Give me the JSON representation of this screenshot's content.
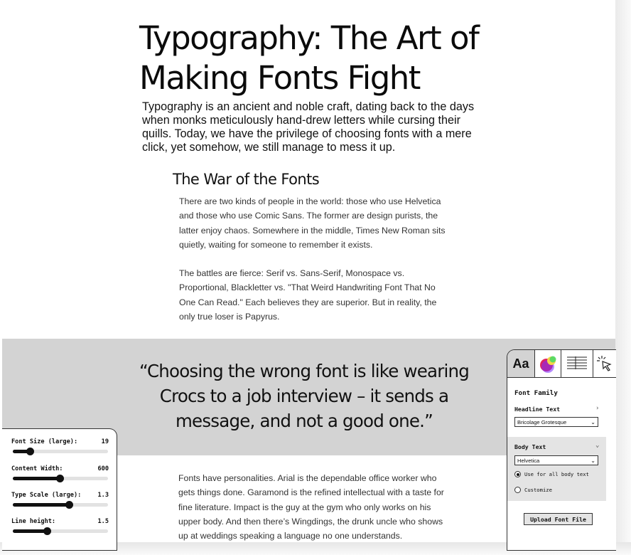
{
  "article": {
    "title": "Typography: The Art of Making Fonts Fight",
    "intro": "Typography is an ancient and noble craft, dating back to the days when monks meticulously hand-drew letters while cursing their quills. Today, we have the privilege of choosing fonts with a mere click, yet somehow, we still manage to mess it up.",
    "section_heading": "The War of the Fonts",
    "paragraphs": [
      "There are two kinds of people in the world: those who use Helvetica and those who use Comic Sans. The former are design purists, the latter enjoy chaos. Somewhere in the middle, Times New Roman sits quietly, waiting for someone to remember it exists.",
      "The battles are fierce: Serif vs. Sans-Serif, Monospace vs. Proportional, Blackletter vs. \"That Weird Handwriting Font That No One Can Read.\" Each believes they are superior. But in reality, the only true loser is Papyrus."
    ],
    "quote": "“Choosing the wrong font is like wearing Crocs to a job interview – it sends a message, and not a good one.”",
    "after_quote": "Fonts have personalities. Arial is the dependable office worker who gets things done. Garamond is the refined intellectual with a taste for fine literature. Impact is the guy at the gym who only works on his upper body. And then there’s Wingdings, the drunk uncle who shows up at weddings speaking a language no one understands."
  },
  "settings": {
    "rows": [
      {
        "label": "Font Size (large):",
        "value": "19",
        "level": 0.18
      },
      {
        "label": "Content Width:",
        "value": "600",
        "level": 0.49
      },
      {
        "label": "Type Scale (large):",
        "value": "1.3",
        "level": 0.59
      },
      {
        "label": "Line height:",
        "value": "1.5",
        "level": 0.36
      }
    ]
  },
  "font_panel": {
    "tabs": [
      {
        "label": "Aa",
        "icon": "typography-icon",
        "active": true
      },
      {
        "icon": "color-palette-icon"
      },
      {
        "icon": "text-layout-icon"
      },
      {
        "icon": "cursor-click-icon"
      }
    ],
    "title": "Font Family",
    "headline_label": "Headline Text",
    "headline_chevron": "›",
    "headline_font": "Bricolage Grotesque",
    "body_label": "Body Text",
    "body_chevron": "⌄",
    "body_font": "Helvetica",
    "radio_all": "Use for all body text",
    "radio_custom": "Customize",
    "upload_label": "Upload Font File",
    "select_arrow": "⌄"
  },
  "colors": {
    "quote_band": "#d3d3d3",
    "panel_border": "#333333",
    "palette": [
      "#e0245e",
      "#7a2cff",
      "#f5d547",
      "#4cd964"
    ]
  }
}
